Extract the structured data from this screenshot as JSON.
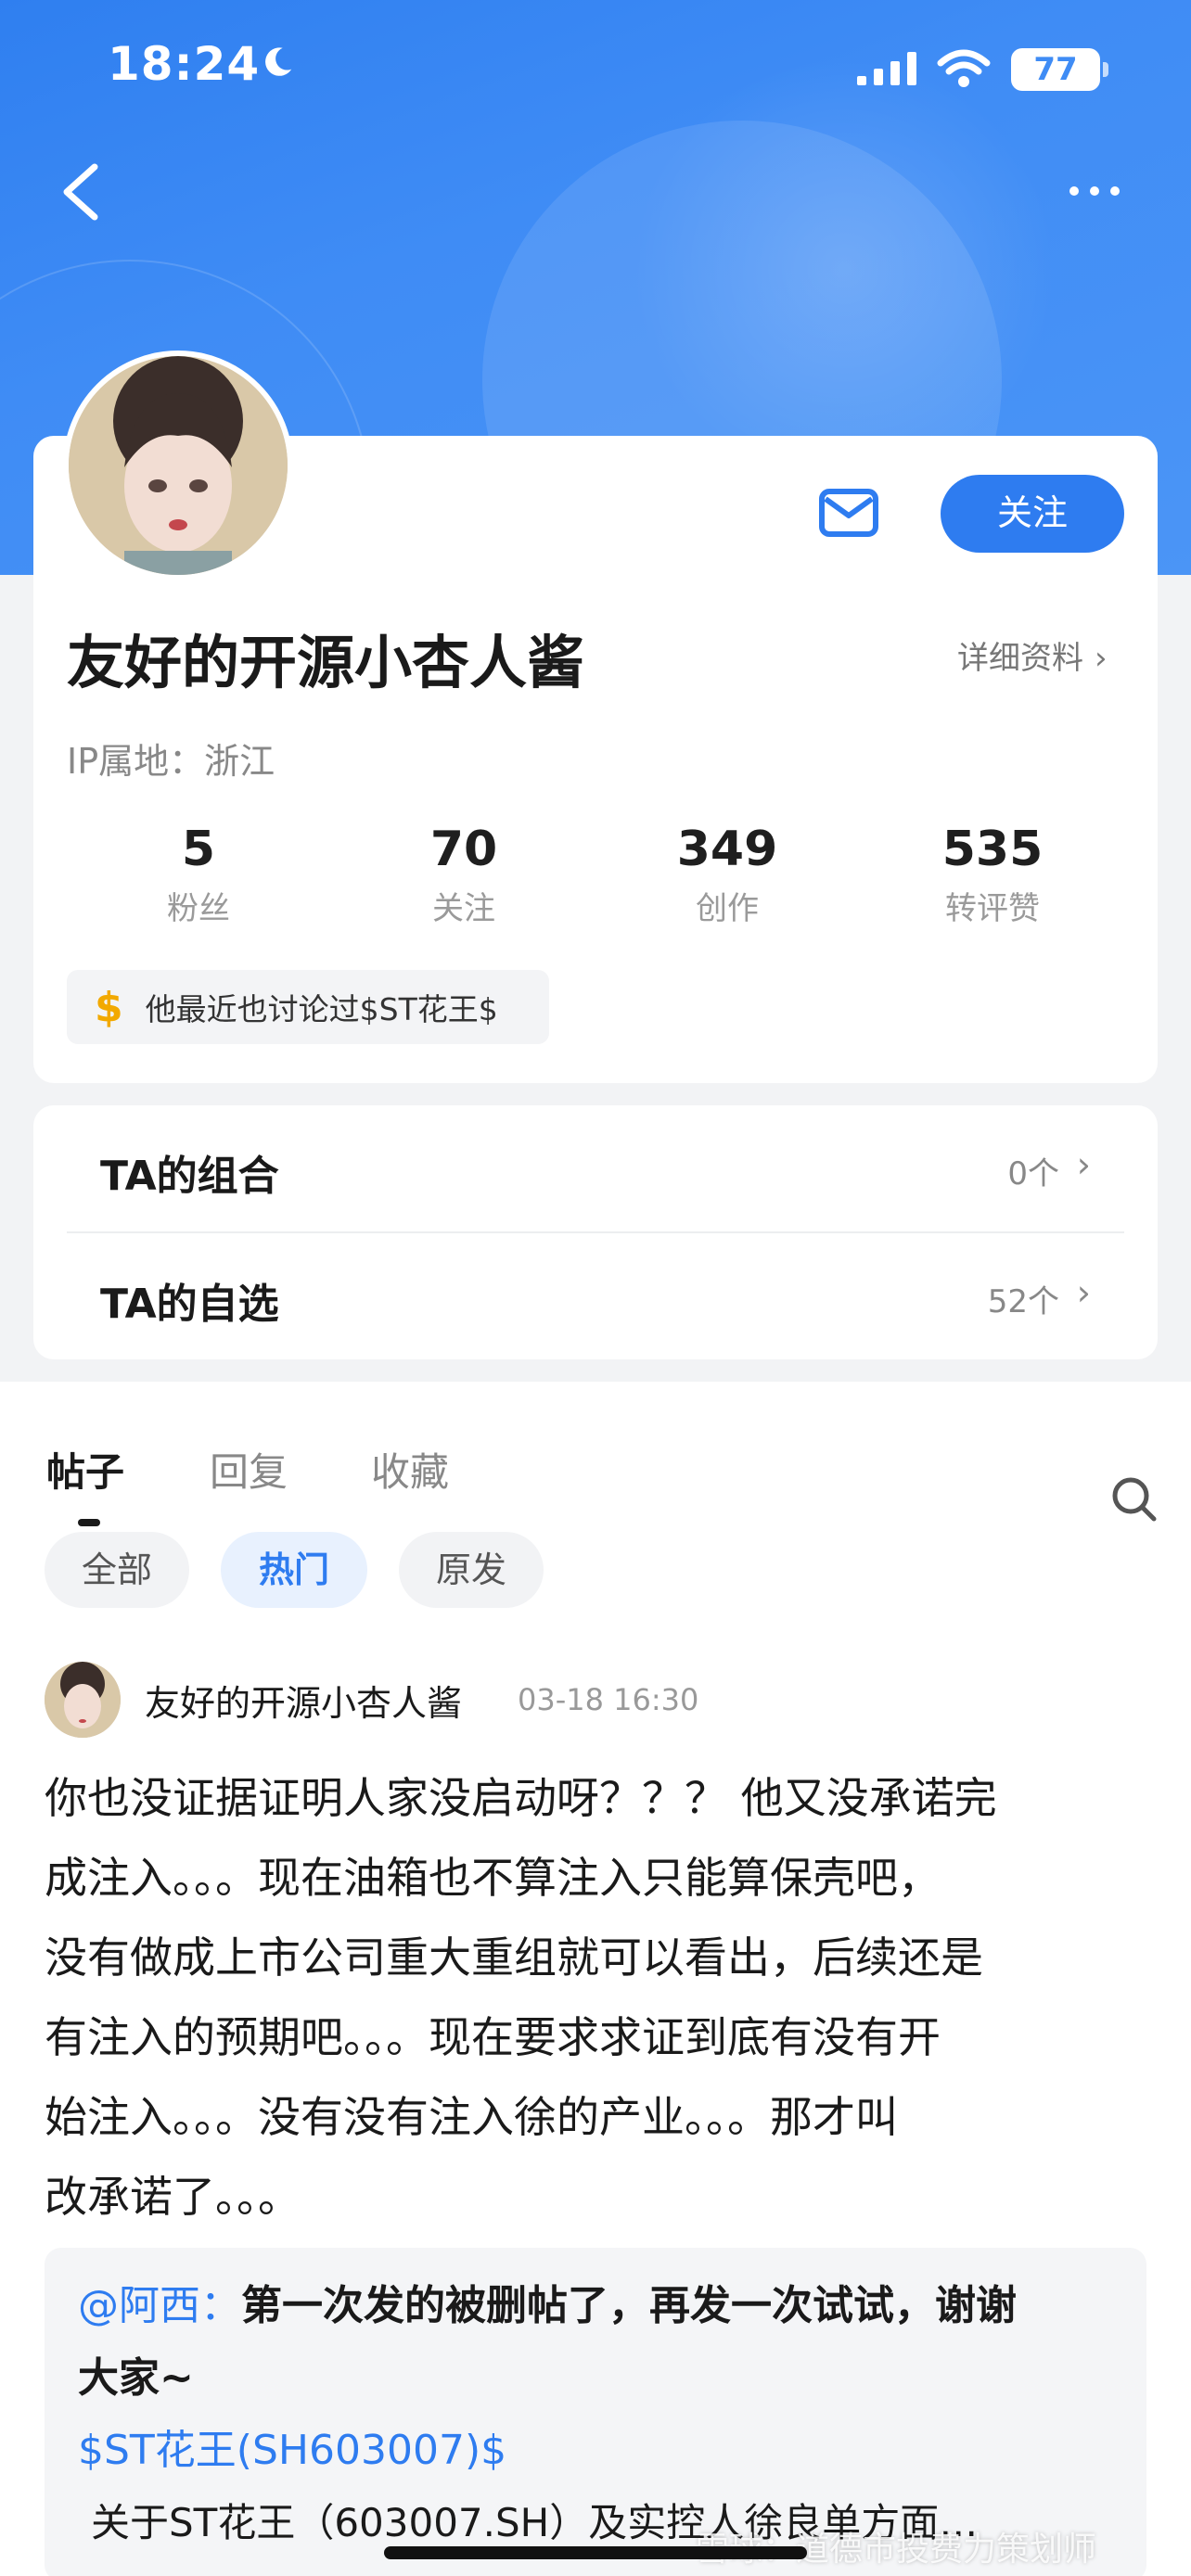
{
  "status_bar": {
    "time": "18:24",
    "battery": "77"
  },
  "profile": {
    "name": "友好的开源小杏人酱",
    "detail_link": "详细资料",
    "ip": "IP属地：浙江",
    "follow_label": "关注",
    "stats": [
      {
        "value": "5",
        "label": "粉丝"
      },
      {
        "value": "70",
        "label": "关注"
      },
      {
        "value": "349",
        "label": "创作"
      },
      {
        "value": "535",
        "label": "转评赞"
      }
    ],
    "discussed": "他最近也讨论过$ST花王$"
  },
  "lists": [
    {
      "label": "TA的组合",
      "count": "0个"
    },
    {
      "label": "TA的自选",
      "count": "52个"
    }
  ],
  "tabs": [
    "帖子",
    "回复",
    "收藏"
  ],
  "filters": [
    "全部",
    "热门",
    "原发"
  ],
  "post": {
    "author": "友好的开源小杏人酱",
    "time": "03-18 16:30",
    "body_lines": [
      "你也没证据证明人家没启动呀？？？ 他又没承诺完",
      "成注入。。。现在油箱也不算注入只能算保壳吧，",
      "没有做成上市公司重大重组就可以看出，后续还是",
      "有注入的预期吧。。。现在要求求证到底有没有开",
      "始注入。。。没有没有注入徐的产业。。。那才叫",
      "改承诺了。。。"
    ],
    "quote": {
      "mention": "@阿西：",
      "text_line1": "第一次发的被删帖了，再发一次试试，谢谢",
      "text_line2": "大家~",
      "stock": "$ST花王(SH603007)$",
      "tail": "关于ST花王（603007.SH）及实控人徐良单方面…"
    }
  },
  "watermark": "雪球：道德市投费力策划师",
  "colors": {
    "brand_blue": "#2e7cf0",
    "hero_blue": "#3f8cf5",
    "accent_gold": "#f2a900"
  }
}
